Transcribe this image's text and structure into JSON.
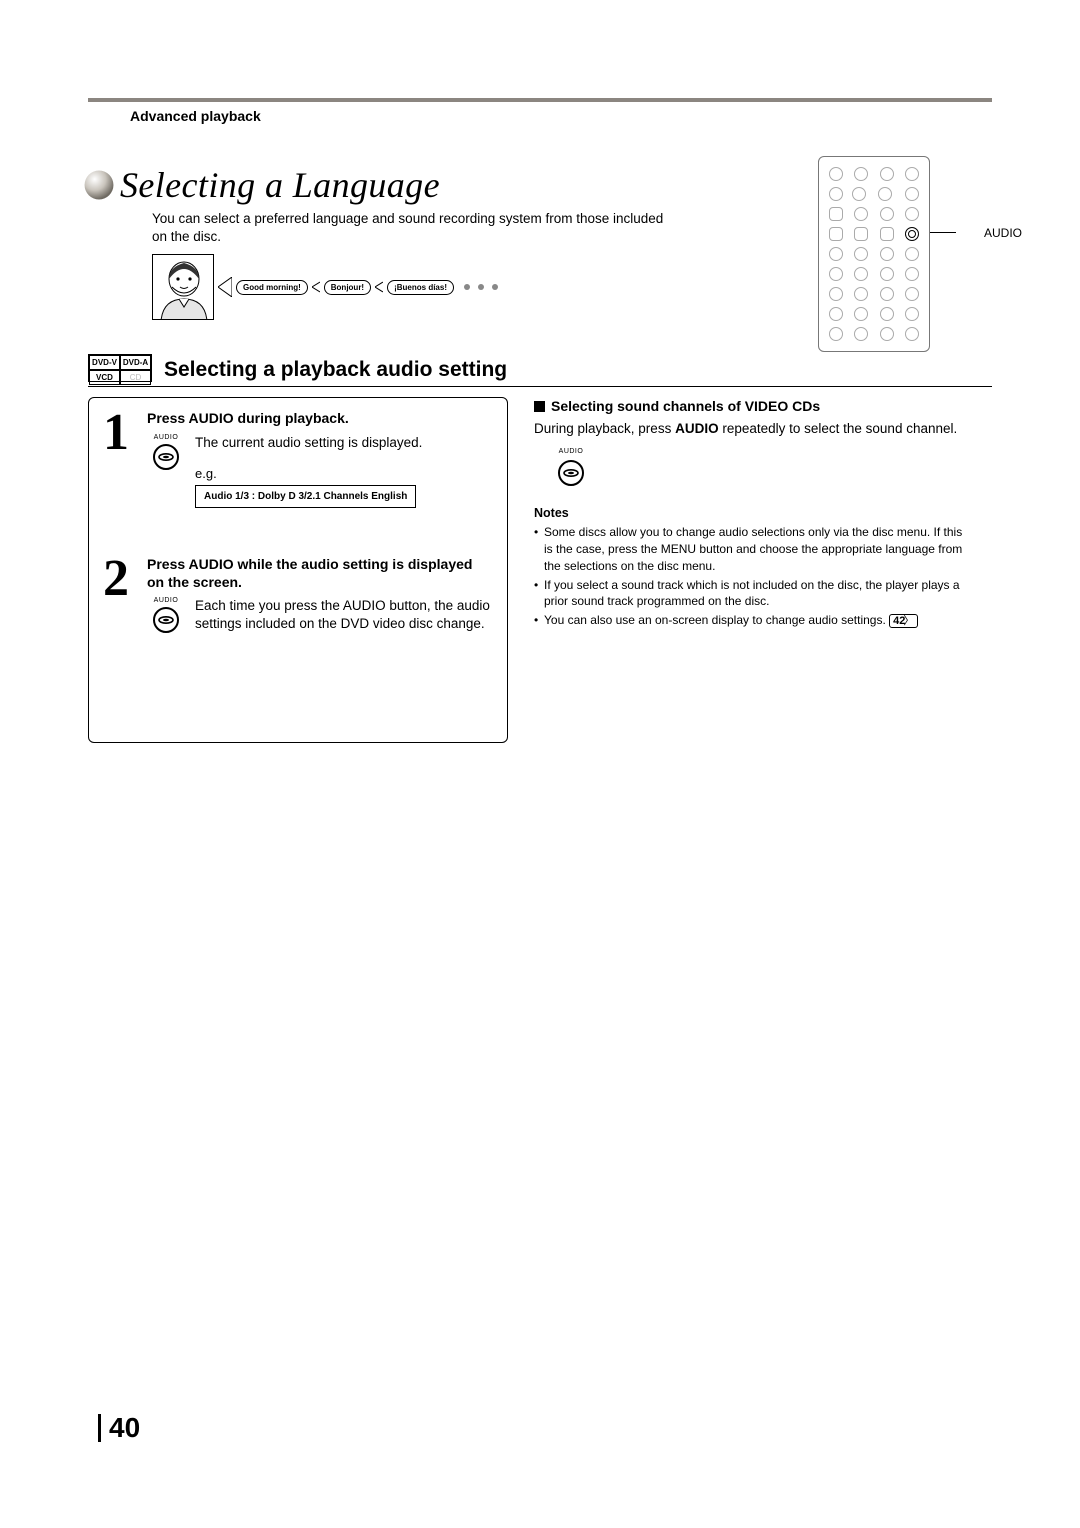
{
  "header": {
    "section": "Advanced playback"
  },
  "title": "Selecting a Language",
  "intro": "You can select a preferred language and sound recording system from those included on the disc.",
  "bubbles": {
    "a": "Good morning!",
    "b": "Bonjour!",
    "c": "¡Buenos días!"
  },
  "remote": {
    "audio_label": "AUDIO"
  },
  "disc_badges": {
    "tl": "DVD-V",
    "tr": "DVD-A",
    "bl": "VCD",
    "br": "CD"
  },
  "sub_heading": "Selecting a playback audio setting",
  "steps": [
    {
      "num": "1",
      "head": "Press AUDIO during playback.",
      "icon_label": "AUDIO",
      "text": "The current audio setting is displayed.",
      "eg_label": "e.g.",
      "osd": "Audio 1/3 :  Dolby D 3/2.1 Channels English"
    },
    {
      "num": "2",
      "head": "Press AUDIO while the audio setting is displayed on the screen.",
      "icon_label": "AUDIO",
      "text": "Each time you press the AUDIO button, the audio settings included on the DVD video disc change."
    }
  ],
  "right": {
    "head": "Selecting sound channels of VIDEO CDs",
    "text_a": "During playback, press ",
    "text_bold": "AUDIO",
    "text_b": " repeatedly to select the sound channel.",
    "icon_label": "AUDIO",
    "notes_head": "Notes",
    "notes": [
      "Some discs allow you to change audio selections only via the disc menu.  If this is the case, press the MENU button and choose the appropriate language from the selections on the disc menu.",
      "If you select a sound track which is not included on the disc, the player plays a prior sound track programmed on the disc.",
      "You can also use an on-screen display to change audio settings."
    ],
    "ref": "42"
  },
  "page_number": "40"
}
